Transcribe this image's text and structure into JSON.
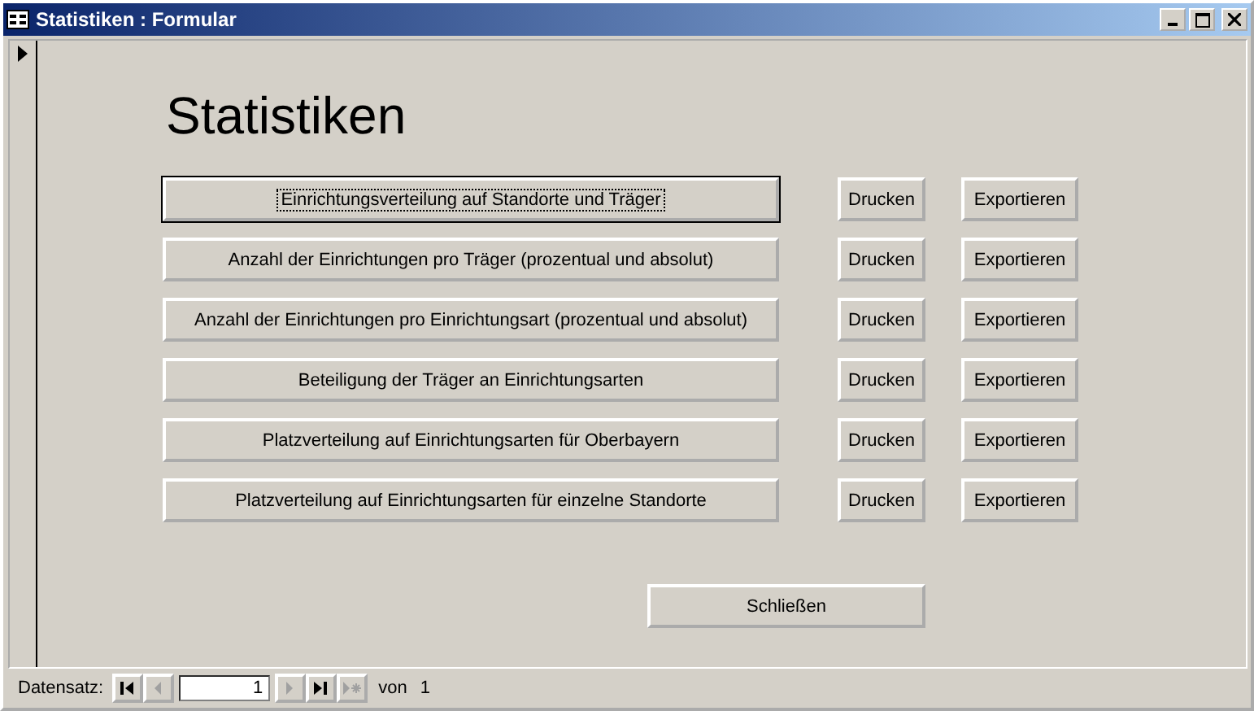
{
  "window": {
    "title": "Statistiken : Formular"
  },
  "heading": "Statistiken",
  "reports": [
    {
      "label": "Einrichtungsverteilung auf Standorte und Träger",
      "focused": true,
      "print": "Drucken",
      "export": "Exportieren"
    },
    {
      "label": "Anzahl der Einrichtungen pro Träger (prozentual und absolut)",
      "focused": false,
      "print": "Drucken",
      "export": "Exportieren"
    },
    {
      "label": "Anzahl der Einrichtungen pro Einrichtungsart (prozentual und absolut)",
      "focused": false,
      "print": "Drucken",
      "export": "Exportieren"
    },
    {
      "label": "Beteiligung der Träger an Einrichtungsarten",
      "focused": false,
      "print": "Drucken",
      "export": "Exportieren"
    },
    {
      "label": "Platzverteilung auf Einrichtungsarten für Oberbayern",
      "focused": false,
      "print": "Drucken",
      "export": "Exportieren"
    },
    {
      "label": "Platzverteilung auf Einrichtungsarten für einzelne Standorte",
      "focused": false,
      "print": "Drucken",
      "export": "Exportieren"
    }
  ],
  "close_button": "Schließen",
  "navigation": {
    "label": "Datensatz:",
    "record": "1",
    "of_label": "von",
    "total": "1",
    "buttons": [
      {
        "kind": "first",
        "disabled": false
      },
      {
        "kind": "prev",
        "disabled": true
      },
      {
        "kind": "next",
        "disabled": true
      },
      {
        "kind": "last",
        "disabled": false
      },
      {
        "kind": "new",
        "disabled": true
      }
    ]
  }
}
